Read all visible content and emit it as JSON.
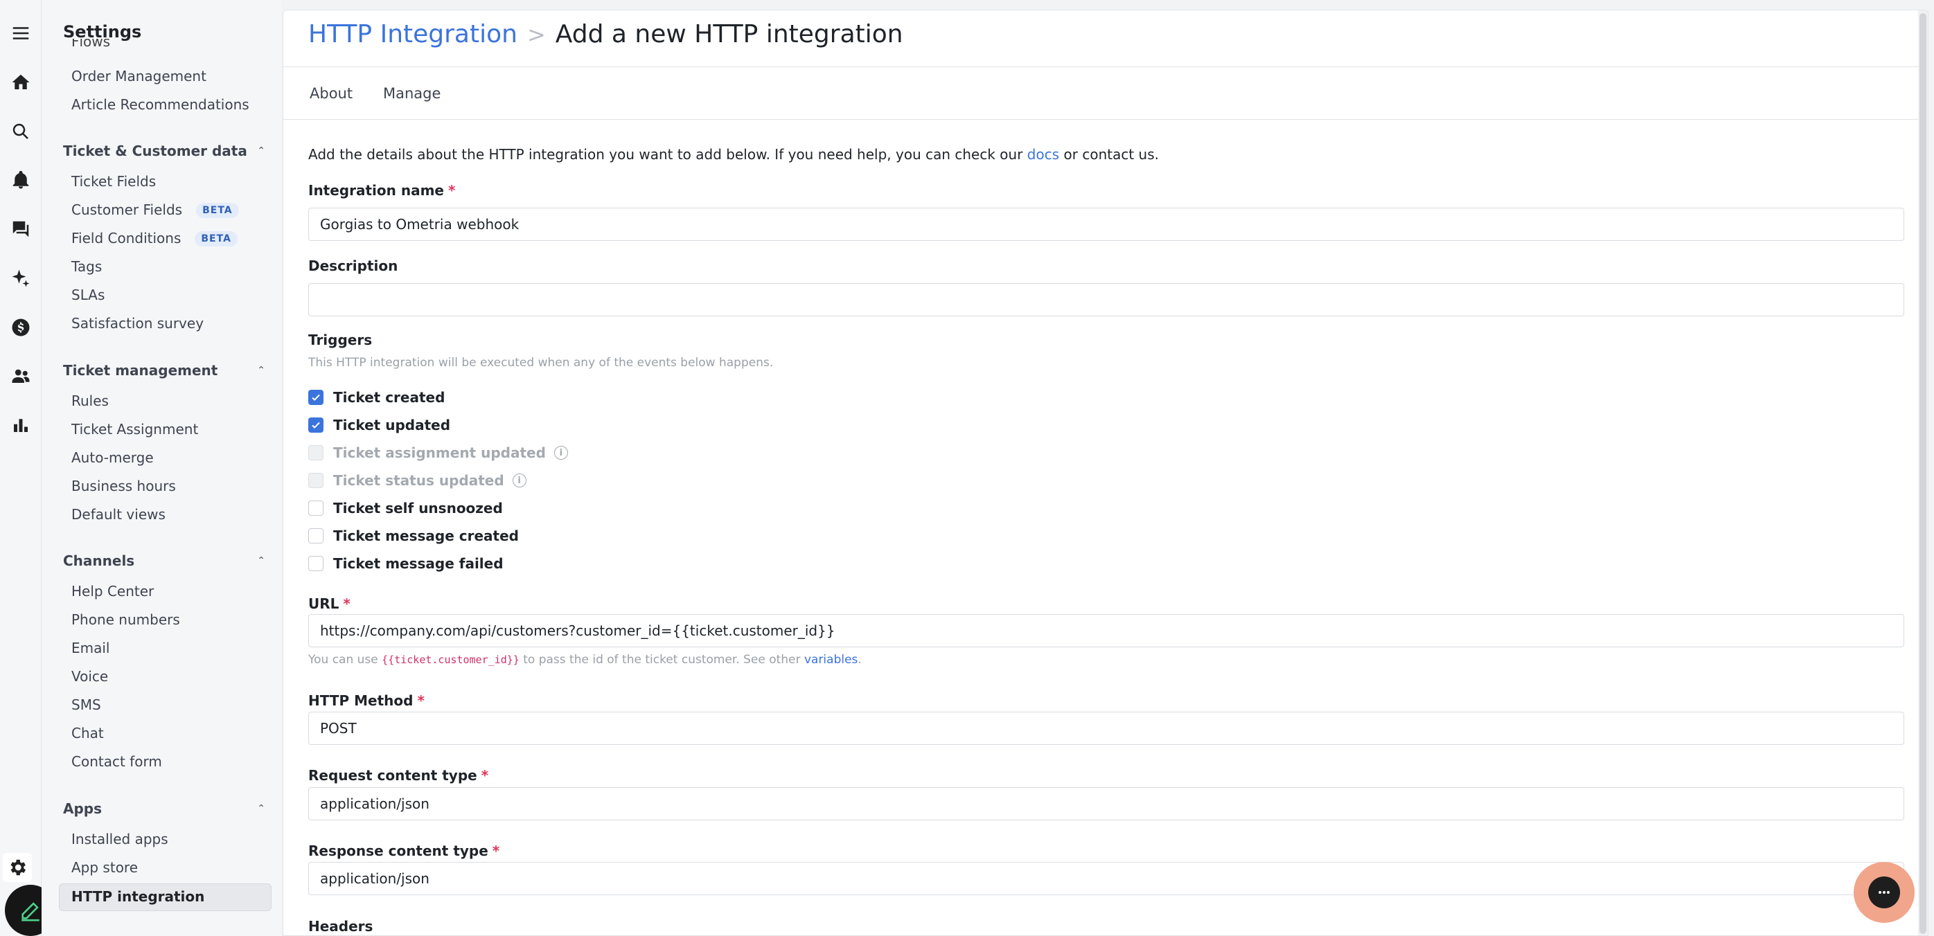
{
  "sidebar": {
    "title": "Settings",
    "cut_item": "Flows",
    "top_items": [
      "Order Management",
      "Article Recommendations"
    ],
    "sections": [
      {
        "title": "Ticket & Customer data",
        "items": [
          {
            "label": "Ticket Fields",
            "badge": ""
          },
          {
            "label": "Customer Fields",
            "badge": "BETA"
          },
          {
            "label": "Field Conditions",
            "badge": "BETA"
          },
          {
            "label": "Tags",
            "badge": ""
          },
          {
            "label": "SLAs",
            "badge": ""
          },
          {
            "label": "Satisfaction survey",
            "badge": ""
          }
        ]
      },
      {
        "title": "Ticket management",
        "items": [
          {
            "label": "Rules"
          },
          {
            "label": "Ticket Assignment"
          },
          {
            "label": "Auto-merge"
          },
          {
            "label": "Business hours"
          },
          {
            "label": "Default views"
          }
        ]
      },
      {
        "title": "Channels",
        "items": [
          {
            "label": "Help Center"
          },
          {
            "label": "Phone numbers"
          },
          {
            "label": "Email"
          },
          {
            "label": "Voice"
          },
          {
            "label": "SMS"
          },
          {
            "label": "Chat"
          },
          {
            "label": "Contact form"
          }
        ]
      },
      {
        "title": "Apps",
        "items": [
          {
            "label": "Installed apps"
          },
          {
            "label": "App store"
          },
          {
            "label": "HTTP integration"
          }
        ]
      }
    ]
  },
  "header": {
    "crumb_link": "HTTP Integration",
    "separator": ">",
    "current": "Add a new HTTP integration"
  },
  "tabs": [
    "About",
    "Manage"
  ],
  "intro": {
    "before": "Add the details about the HTTP integration you want to add below. If you need help, you can check our ",
    "link": "docs",
    "after": " or contact us."
  },
  "form": {
    "name_label": "Integration name",
    "name_value": "Gorgias to Ometria webhook",
    "description_label": "Description",
    "description_value": "",
    "triggers_label": "Triggers",
    "triggers_help": "This HTTP integration will be executed when any of the events below happens.",
    "triggers": [
      {
        "label": "Ticket created",
        "checked": true,
        "disabled": false,
        "info": false
      },
      {
        "label": "Ticket updated",
        "checked": true,
        "disabled": false,
        "info": false
      },
      {
        "label": "Ticket assignment updated",
        "checked": false,
        "disabled": true,
        "info": true
      },
      {
        "label": "Ticket status updated",
        "checked": false,
        "disabled": true,
        "info": true
      },
      {
        "label": "Ticket self unsnoozed",
        "checked": false,
        "disabled": false,
        "info": false
      },
      {
        "label": "Ticket message created",
        "checked": false,
        "disabled": false,
        "info": false
      },
      {
        "label": "Ticket message failed",
        "checked": false,
        "disabled": false,
        "info": false
      }
    ],
    "url_label": "URL",
    "url_value": "https://company.com/api/customers?customer_id={{ticket.customer_id}}",
    "url_help_before": "You can use ",
    "url_help_code": "{{ticket.customer_id}}",
    "url_help_middle": " to pass the id of the ticket customer. See other ",
    "url_help_link": "variables",
    "url_help_after": ".",
    "method_label": "HTTP Method",
    "method_value": "POST",
    "request_label": "Request content type",
    "request_value": "application/json",
    "response_label": "Response content type",
    "response_value": "application/json",
    "headers_label": "Headers",
    "required_mark": "*"
  },
  "icons": {
    "rail": [
      "menu-icon",
      "home-icon",
      "search-icon",
      "bell-icon",
      "chat-icon",
      "sparkle-icon",
      "dollar-icon",
      "users-icon",
      "bar-chart-icon",
      "gear-icon",
      "pencil-icon"
    ],
    "info_glyph": "i"
  },
  "colors": {
    "accent": "#3b74dd",
    "required": "#e0345a",
    "chat_widget": "#f1a58b"
  }
}
